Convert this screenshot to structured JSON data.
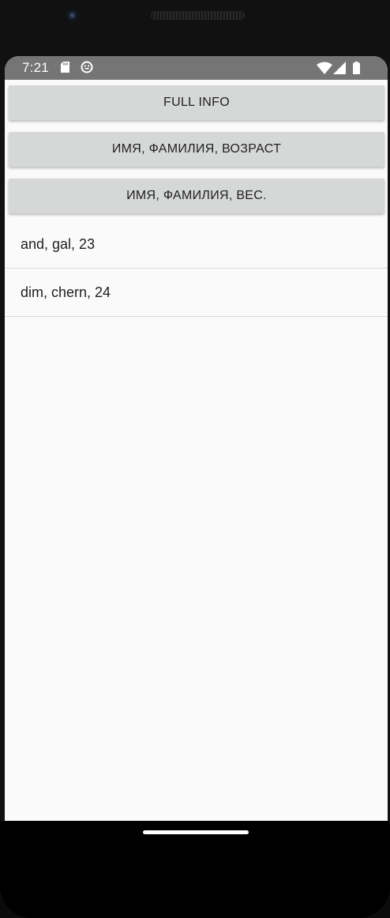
{
  "status_bar": {
    "time": "7:21",
    "left_icons": [
      "sd-card-icon",
      "smile-icon"
    ],
    "right_icons": [
      "wifi-icon",
      "signal-icon",
      "battery-icon"
    ]
  },
  "buttons": {
    "full_info": "FULL INFO",
    "name_surname_age": "ИМЯ, ФАМИЛИЯ, ВОЗРАСТ",
    "name_surname_weight": "ИМЯ, ФАМИЛИЯ, ВЕС."
  },
  "list": {
    "items": [
      "and, gal, 23",
      "dim, chern, 24"
    ]
  },
  "colors": {
    "status_bar": "#757575",
    "button_bg": "#d6d7d7",
    "screen_bg": "#fafafa"
  }
}
